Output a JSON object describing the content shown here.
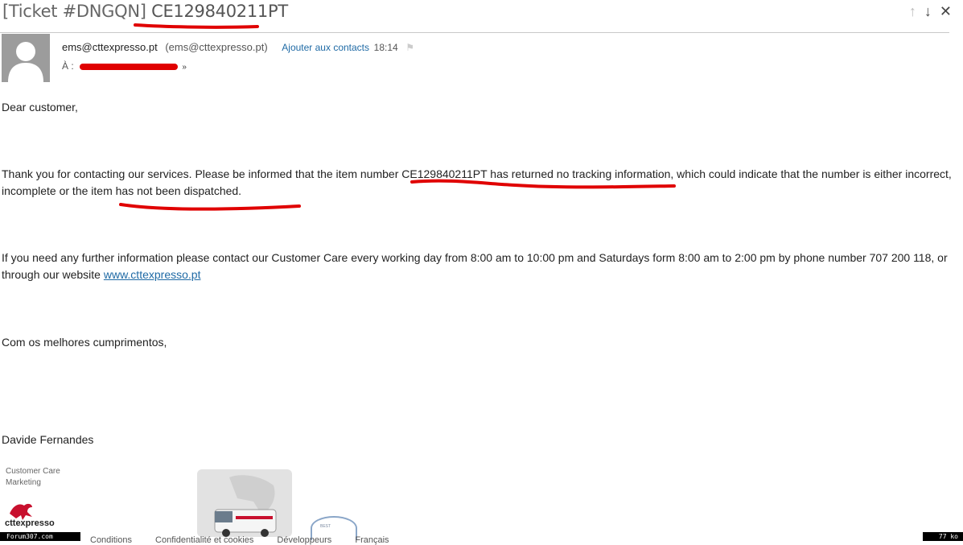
{
  "header": {
    "ticket_prefix": "[Ticket #DNGQN]",
    "ticket_number": "CE129840211PT"
  },
  "nav": {
    "up_icon": "↑",
    "down_icon": "↓",
    "close_icon": "✕"
  },
  "sender": {
    "name": "ems@cttexpresso.pt",
    "address": "(ems@cttexpresso.pt)",
    "add_contact": "Ajouter aux contacts",
    "time": "18:14",
    "to_label": "À :"
  },
  "message": {
    "greeting": "Dear customer,",
    "para1_a": "Thank you for contacting our services. Please be informed that the item number ",
    "para1_item": "CE129840211PT",
    "para1_b": " has returned no tracking information, which could indicate that the number is either incorrect, incomplete or the item has not been dispatched.",
    "para2_a": "If you need any further information please contact our Customer Care every working day from 8:00 am to 10:00 pm and Saturdays form 8:00 am to 2:00 pm by phone number 707 200 118, or through our website ",
    "para2_link": "www.cttexpresso.pt",
    "closing": "Com os melhores cumprimentos,",
    "signature_name": "Davide Fernandes",
    "signature_dept1": "Customer Care",
    "signature_dept2": "Marketing",
    "logo_text": "cttexpresso",
    "badge_text": "BEST"
  },
  "footer": {
    "links": [
      "Conditions",
      "Confidentialité et cookies",
      "Développeurs",
      "Français"
    ],
    "watermark_left": "Forum307.com",
    "watermark_right": "77 ko"
  },
  "colors": {
    "red_marker": "#e00000",
    "link": "#1f6aa5"
  }
}
